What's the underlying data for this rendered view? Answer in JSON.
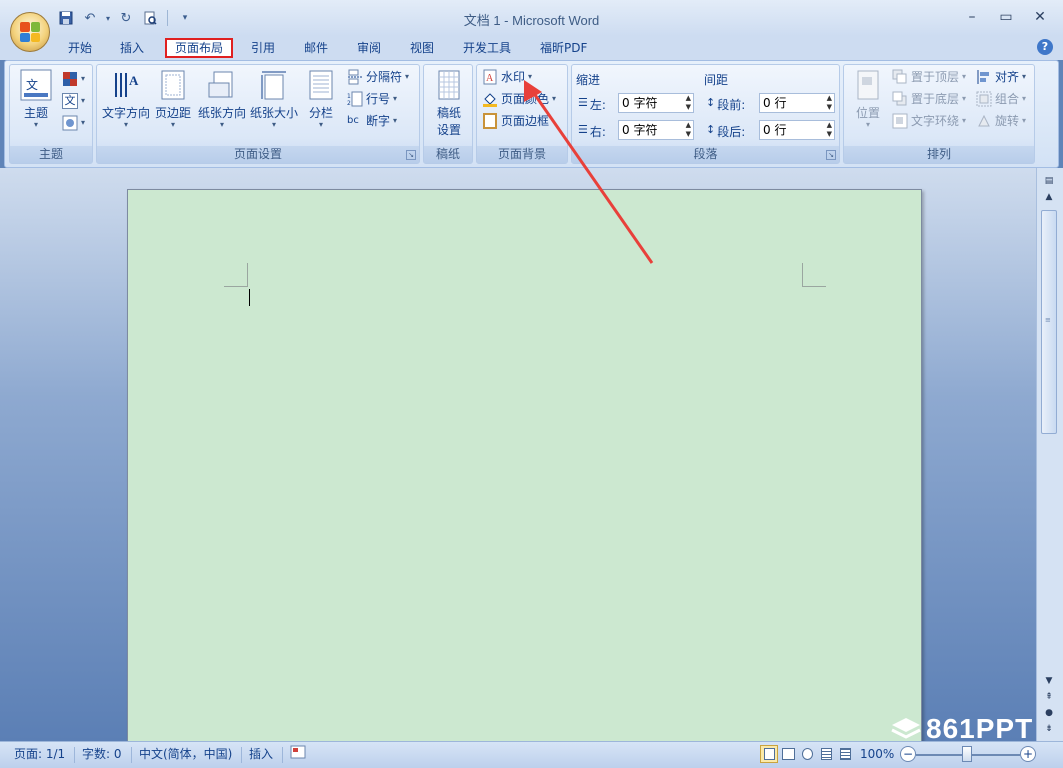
{
  "window": {
    "title": "文档 1 - Microsoft Word"
  },
  "quick_access": {
    "items": [
      "save-icon",
      "undo-icon",
      "redo-icon",
      "print-preview-icon",
      "customize-icon"
    ]
  },
  "tabs": [
    {
      "label": "开始",
      "active": false
    },
    {
      "label": "插入",
      "active": false
    },
    {
      "label": "页面布局",
      "active": true
    },
    {
      "label": "引用",
      "active": false
    },
    {
      "label": "邮件",
      "active": false
    },
    {
      "label": "审阅",
      "active": false
    },
    {
      "label": "视图",
      "active": false
    },
    {
      "label": "开发工具",
      "active": false
    },
    {
      "label": "福昕PDF",
      "active": false
    }
  ],
  "ribbon": {
    "theme": {
      "label": "主题",
      "btn_theme": "主题",
      "btn_colors_glyph": "",
      "btn_fonts_glyph": "文",
      "btn_effects_glyph": ""
    },
    "page_setup": {
      "label": "页面设置",
      "text_direction": "文字方向",
      "margins": "页边距",
      "orientation": "纸张方向",
      "size": "纸张大小",
      "columns": "分栏",
      "breaks": "分隔符",
      "line_numbers": "行号",
      "hyphenation": "断字",
      "hyph_glyph": "bc"
    },
    "manuscript": {
      "label": "稿纸",
      "btn_line1": "稿纸",
      "btn_line2": "设置"
    },
    "background": {
      "label": "页面背景",
      "watermark": "水印",
      "page_color": "页面颜色",
      "page_borders": "页面边框"
    },
    "paragraph": {
      "label": "段落",
      "indent_title": "缩进",
      "spacing_title": "间距",
      "indent_left_label": "左:",
      "indent_left_value": "0 字符",
      "indent_right_label": "右:",
      "indent_right_value": "0 字符",
      "space_before_label": "段前:",
      "space_before_value": "0 行",
      "space_after_label": "段后:",
      "space_after_value": "0 行"
    },
    "arrange": {
      "label": "排列",
      "position_line1": "位置",
      "bring_front": "置于顶层",
      "send_back": "置于底层",
      "text_wrap": "文字环绕",
      "align": "对齐",
      "group": "组合",
      "rotate": "旋转"
    }
  },
  "status": {
    "page": "页面: 1/1",
    "words": "字数: 0",
    "language": "中文(简体，中国)",
    "mode": "插入",
    "zoom": "100%",
    "zoom_level": 1.0
  },
  "watermark_logo": {
    "text": "861PPT"
  },
  "colors": {
    "page_color": "#cce8d0",
    "accent_red": "#e02020"
  }
}
